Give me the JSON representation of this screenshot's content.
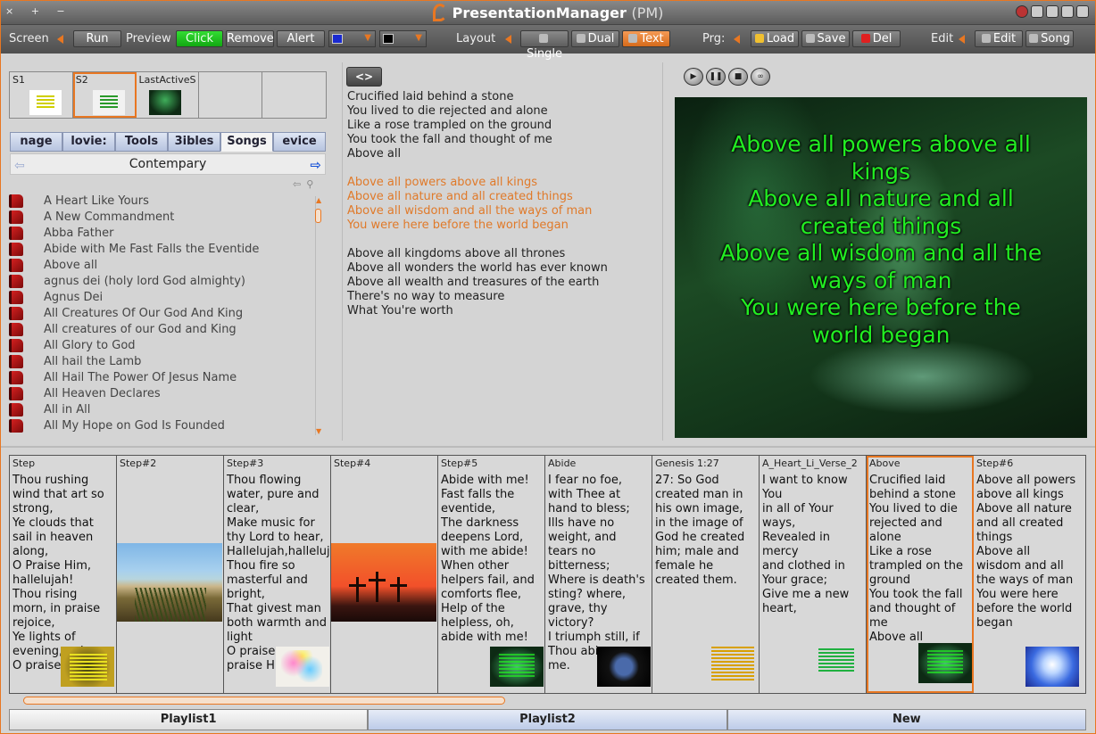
{
  "titlebar": {
    "title": "PresentationManager",
    "subtitle": "(PM)"
  },
  "toolbar": {
    "screen_label": "Screen",
    "run": "Run",
    "preview_label": "Preview",
    "click": "Click",
    "remove": "Remove",
    "alert": "Alert",
    "color1": "#1a2ad0",
    "color2": "#000000",
    "layout_label": "Layout",
    "single": "Single",
    "dual": "Dual",
    "text": "Text",
    "prg_label": "Prg:",
    "load": "Load",
    "save": "Save",
    "del": "Del",
    "edit_label": "Edit",
    "edit": "Edit",
    "song": "Song"
  },
  "slots": [
    {
      "label": "S1",
      "thumb": "t1"
    },
    {
      "label": "S2",
      "thumb": "t2",
      "active": true
    },
    {
      "label": "LastActiveS",
      "thumb": "t3"
    },
    {
      "label": ""
    },
    {
      "label": ""
    }
  ],
  "tabs": [
    "nage",
    "lovie:",
    "Tools",
    "3ibles",
    "Songs",
    "evice"
  ],
  "active_tab": 4,
  "category": "Contempary",
  "songs": [
    "A Heart Like Yours",
    "A New Commandment",
    "Abba Father",
    "Abide with Me Fast Falls the Eventide",
    "Above all",
    "agnus dei (holy lord God almighty)",
    "Agnus Dei",
    "All Creatures Of Our God And King",
    "All creatures of our God and King",
    "All Glory to God",
    "All hail the Lamb",
    "All Hail The Power Of Jesus Name",
    "All Heaven Declares",
    "All in All",
    "All My Hope on God Is Founded"
  ],
  "editor": {
    "code_button": "<>",
    "verse1": [
      "Crucified laid behind a stone",
      "You lived to die rejected and alone",
      "Like a rose trampled on the ground",
      "You took the fall and thought of me",
      "Above all"
    ],
    "chorus": [
      "Above all powers above all kings",
      "Above all nature and all created things",
      "Above all wisdom and all the ways of man",
      "You were here before the world began"
    ],
    "verse2": [
      "Above all kingdoms above all thrones",
      "Above all wonders the world has ever known",
      "Above all wealth and treasures of the earth",
      "There's no way to measure",
      "What You're worth"
    ]
  },
  "preview": {
    "text_color": "#22ee22",
    "lines": [
      "Above all powers above all",
      "kings",
      "Above all nature and all",
      "created things",
      "Above all wisdom and all the",
      "ways of man",
      "You were here before the",
      "world began"
    ]
  },
  "playlist": [
    {
      "title": "Step",
      "text": "Thou rushing wind that art so strong,\nYe clouds that sail in heaven along,\nO Praise Him, hallelujah!\nThou rising morn, in praise rejoice,\nYe lights of evening, voice –\nO praise"
    },
    {
      "title": "Step#2",
      "text": ""
    },
    {
      "title": "Step#3",
      "text": "Thou flowing water, pure and clear,\nMake music for thy Lord to hear,\nHallelujah,halleluj.\nThou fire so masterful and bright,\nThat givest man both warmth and light\nO praise\npraise Hi"
    },
    {
      "title": "Step#4",
      "text": ""
    },
    {
      "title": "Step#5",
      "text": "Abide with me! Fast falls the eventide,\nThe darkness deepens Lord, with me abide!\nWhen other helpers fail, and comforts flee,\nHelp of the helpless, oh, abide with me!"
    },
    {
      "title": "Abide",
      "text": "I fear no foe, with Thee at hand to bless;\nIlls have no weight, and tears no bitterness;\nWhere is death's sting? where, grave, thy victory?\nI triumph still, if Thou abi\nme."
    },
    {
      "title": "Genesis 1:27",
      "text": "27:   So God created man in his own image, in the image of God he created him; male and female he created them."
    },
    {
      "title": "A_Heart_Li_Verse_2",
      "text": "I want to know You\nin all of Your ways,\nRevealed in mercy\nand clothed in Your grace;\nGive me a new heart,"
    },
    {
      "title": "Above",
      "text": "Crucified laid behind a stone\nYou lived to die rejected and alone\nLike a rose trampled on the ground\nYou took the fall and thought of me\nAbove all",
      "active": true
    },
    {
      "title": "Step#6",
      "text": "Above all powers above all kings\nAbove all nature and all created things\nAbove all wisdom and all the ways of man\nYou were here before the world began"
    }
  ],
  "bottom_tabs": [
    "Playlist1",
    "Playlist2",
    "New"
  ],
  "accent": "#e87722"
}
